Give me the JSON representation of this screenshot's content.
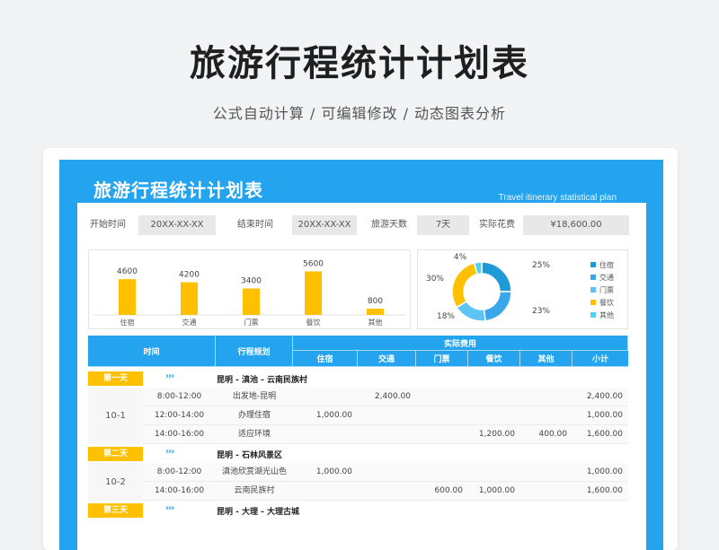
{
  "hero": {
    "title": "旅游行程统计计划表",
    "subtitle": "公式自动计算 /  可编辑修改  / 动态图表分析"
  },
  "sheet": {
    "title": "旅游行程统计计划表",
    "subtitle": "Travel itinerary statistical plan"
  },
  "info": {
    "start_label": "开始时间",
    "start_value": "20XX-XX-XX",
    "end_label": "结束时间",
    "end_value": "20XX-XX-XX",
    "days_label": "旅游天数",
    "days_value": "7天",
    "cost_label": "实际花费",
    "cost_value": "¥18,600.00"
  },
  "chart_data": [
    {
      "type": "bar",
      "categories": [
        "住宿",
        "交通",
        "门票",
        "餐饮",
        "其他"
      ],
      "values": [
        4600,
        4200,
        3400,
        5600,
        800
      ],
      "color": "#ffc000",
      "ylim": [
        0,
        6000
      ]
    },
    {
      "type": "pie",
      "labels": [
        "住宿",
        "交通",
        "门票",
        "餐饮",
        "其他"
      ],
      "values": [
        25,
        23,
        18,
        30,
        4
      ],
      "value_labels": [
        "25%",
        "23%",
        "18%",
        "30%",
        "4%"
      ],
      "colors": [
        "#1e9ad6",
        "#3aa7ea",
        "#5bc4f5",
        "#ffc000",
        "#4fd2f0"
      ],
      "legend": "right",
      "donut": true
    }
  ],
  "table": {
    "headers": {
      "time": "时间",
      "plan": "行程规划",
      "actual": "实际费用",
      "cols": [
        "住宿",
        "交通",
        "门票",
        "餐饮",
        "其他",
        "小计"
      ]
    },
    "days": [
      {
        "badge": "第一天",
        "arrow": "›››",
        "title": "昆明 - 滇池 - 云南民族村",
        "date": "10-1",
        "rows": [
          {
            "time": "8:00-12:00",
            "plan": "出发地-昆明",
            "vals": [
              "",
              "2,400.00",
              "",
              "",
              "",
              "2,400.00"
            ]
          },
          {
            "time": "12:00-14:00",
            "plan": "办理住宿",
            "vals": [
              "1,000.00",
              "",
              "",
              "",
              "",
              "1,000.00"
            ]
          },
          {
            "time": "14:00-16:00",
            "plan": "适应环境",
            "vals": [
              "",
              "",
              "",
              "1,200.00",
              "400.00",
              "1,600.00"
            ]
          }
        ]
      },
      {
        "badge": "第二天",
        "arrow": "›››",
        "title": "昆明 - 石林风景区",
        "date": "10-2",
        "rows": [
          {
            "time": "8:00-12:00",
            "plan": "滇池欣赏湖光山色",
            "vals": [
              "1,000.00",
              "",
              "",
              "",
              "",
              "1,000.00"
            ]
          },
          {
            "time": "14:00-16:00",
            "plan": "云南民族村",
            "vals": [
              "",
              "",
              "600.00",
              "1,000.00",
              "",
              "1,600.00"
            ]
          }
        ]
      },
      {
        "badge": "第三天",
        "arrow": "›››",
        "title": "昆明 - 大理 - 大理古城",
        "date": "",
        "rows": []
      }
    ]
  }
}
